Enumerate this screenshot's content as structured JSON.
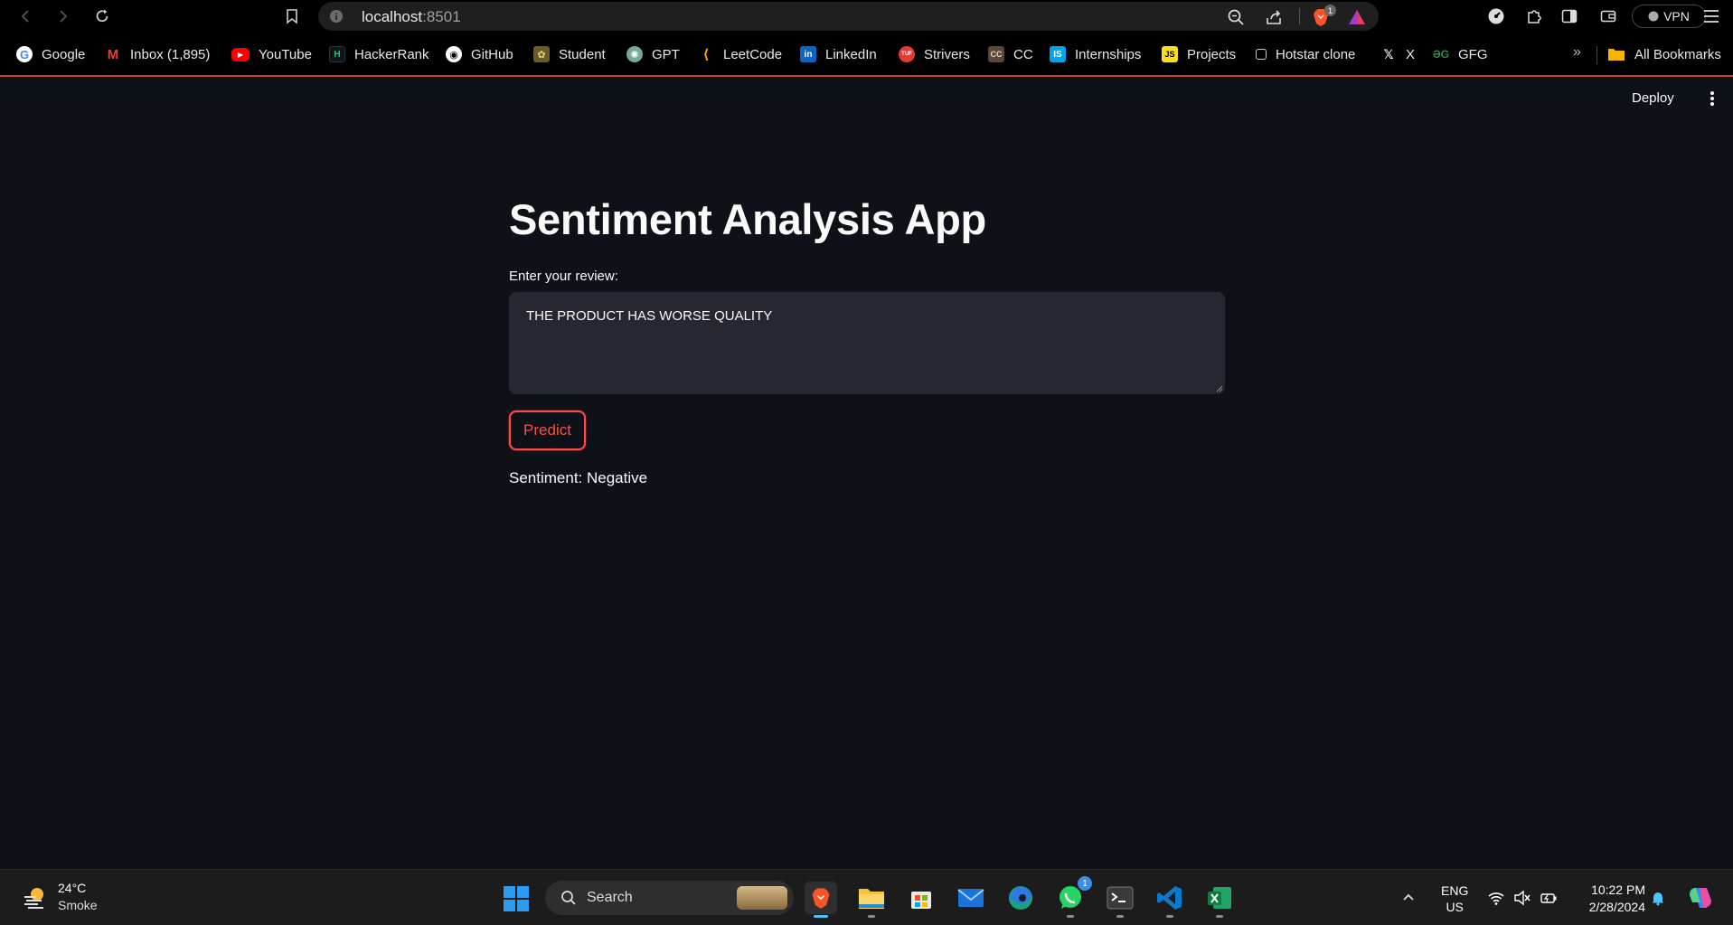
{
  "browser": {
    "url_host": "localhost",
    "url_port": ":8501",
    "brave_badge": "1",
    "vpn_label": "VPN"
  },
  "bookmarks": {
    "items": [
      {
        "label": "Google",
        "icon": "google-icon"
      },
      {
        "label": "Inbox (1,895)",
        "icon": "gmail-icon"
      },
      {
        "label": "YouTube",
        "icon": "youtube-icon"
      },
      {
        "label": "HackerRank",
        "icon": "hackerrank-icon"
      },
      {
        "label": "GitHub",
        "icon": "github-icon"
      },
      {
        "label": "Student",
        "icon": "student-icon"
      },
      {
        "label": "GPT",
        "icon": "chatgpt-icon"
      },
      {
        "label": "LeetCode",
        "icon": "leetcode-icon"
      },
      {
        "label": "LinkedIn",
        "icon": "linkedin-icon"
      },
      {
        "label": "Strivers",
        "icon": "strivers-icon"
      },
      {
        "label": "CC",
        "icon": "codechef-icon"
      },
      {
        "label": "Internships",
        "icon": "internshala-icon"
      },
      {
        "label": "Projects",
        "icon": "js-icon"
      },
      {
        "label": "Hotstar clone",
        "icon": "page-icon"
      },
      {
        "label": "X",
        "icon": "x-icon"
      },
      {
        "label": "GFG",
        "icon": "gfg-icon"
      }
    ],
    "more": "»",
    "all_bookmarks": "All Bookmarks"
  },
  "app": {
    "deploy_label": "Deploy",
    "title": "Sentiment Analysis App",
    "input_label": "Enter your review:",
    "review_text": "THE PRODUCT HAS WORSE QUALITY",
    "predict_label": "Predict",
    "result_text": "Sentiment: Negative"
  },
  "taskbar": {
    "weather_temp": "24°C",
    "weather_desc": "Smoke",
    "search_label": "Search",
    "whatsapp_badge": "1",
    "lang_top": "ENG",
    "lang_bottom": "US",
    "time": "10:22 PM",
    "date": "2/28/2024"
  },
  "colors": {
    "background": "#0e1117",
    "accent": "#ff4b4b",
    "input_bg": "#262730"
  }
}
